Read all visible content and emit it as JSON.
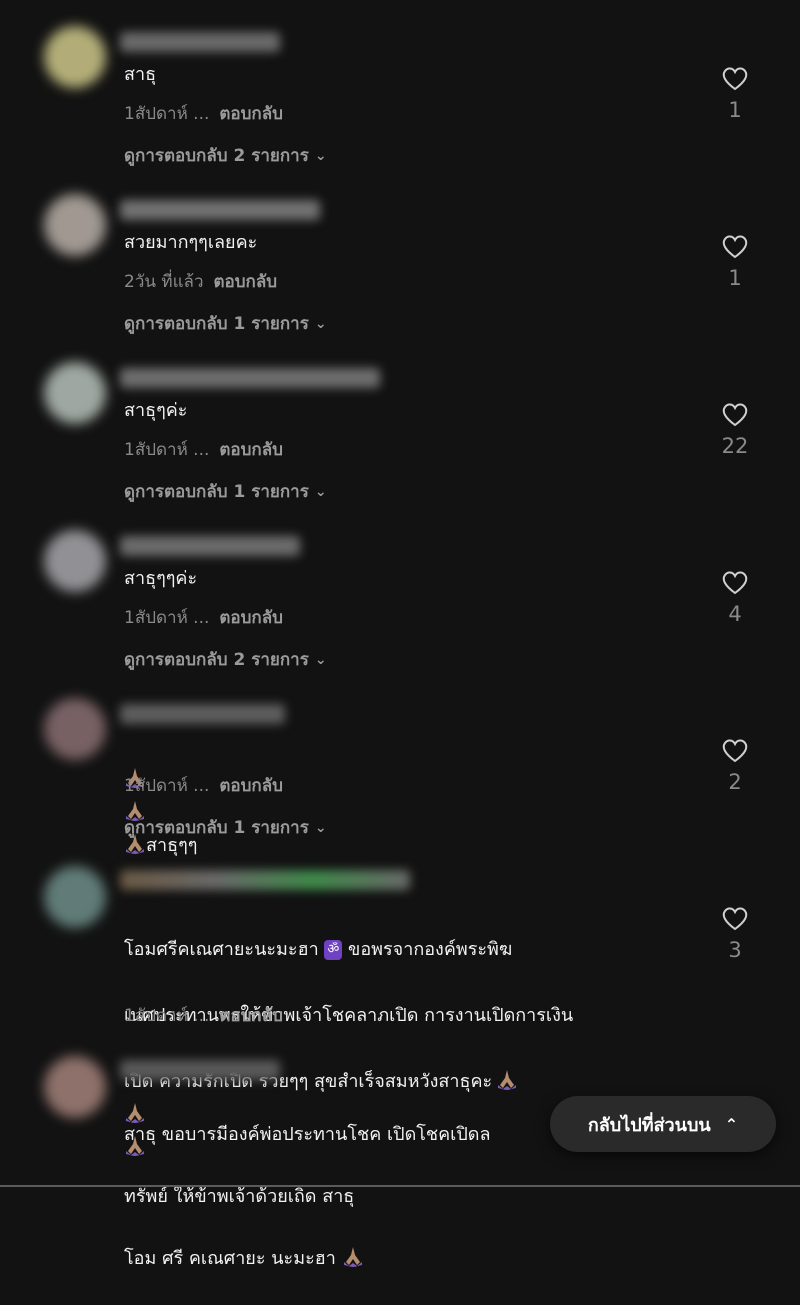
{
  "back_to_top": {
    "label": "กลับไปที่ส่วนบน",
    "icon": "double-chevron-up-icon"
  },
  "comments": [
    {
      "text": "สาธุ",
      "meta": "1สัปดาห์ ...",
      "reply": "ตอบกลับ",
      "replies": "ดูการตอบกลับ 2 รายการ",
      "likes": "1"
    },
    {
      "text": "สวยมากๆๆเลยคะ",
      "meta": "2วัน ที่แล้ว",
      "reply": "ตอบกลับ",
      "replies": "ดูการตอบกลับ 1 รายการ",
      "likes": "1"
    },
    {
      "text": "สาธุๆค่ะ",
      "meta": "1สัปดาห์ ...",
      "reply": "ตอบกลับ",
      "replies": "ดูการตอบกลับ 1 รายการ",
      "likes": "22"
    },
    {
      "text": "สาธุๆๆค่ะ",
      "meta": "1สัปดาห์ ...",
      "reply": "ตอบกลับ",
      "replies": "ดูการตอบกลับ 2 รายการ",
      "likes": "4"
    },
    {
      "text": "สาธุๆๆ",
      "meta": "1สัปดาห์ ...",
      "reply": "ตอบกลับ",
      "replies": "ดูการตอบกลับ 1 รายการ",
      "likes": "2"
    },
    {
      "text_line1_a": "โอมศรีคเณศายะนะมะฮา",
      "text_line1_b": "ขอพรจากองค์พระพิฆ",
      "text_line2": "เนศประทานพรให้ข้าพเจ้าโชคลาภเปิด การงานเปิดการเงิน",
      "text_line3": "เปิด ความรักเปิด รวยๆๆ สุขสำเร็จสมหวังสาธุคะ",
      "meta": "1สัปดาห์ ...",
      "reply": "ตอบกลับ",
      "likes": "3"
    },
    {
      "text_line1": "สาธุ ขอบารมีองค์พ่อประทานโชค เปิดโชคเปิดล",
      "text_line2": "ทรัพย์ ให้ข้าพเจ้าด้วยเถิด สาธุ",
      "text_line3": "โอม ศรี คเณศายะ นะมะฮา"
    }
  ],
  "colors": {
    "background": "#121212",
    "muted": "#8a8a8a",
    "om_badge": "#6f42c1"
  }
}
